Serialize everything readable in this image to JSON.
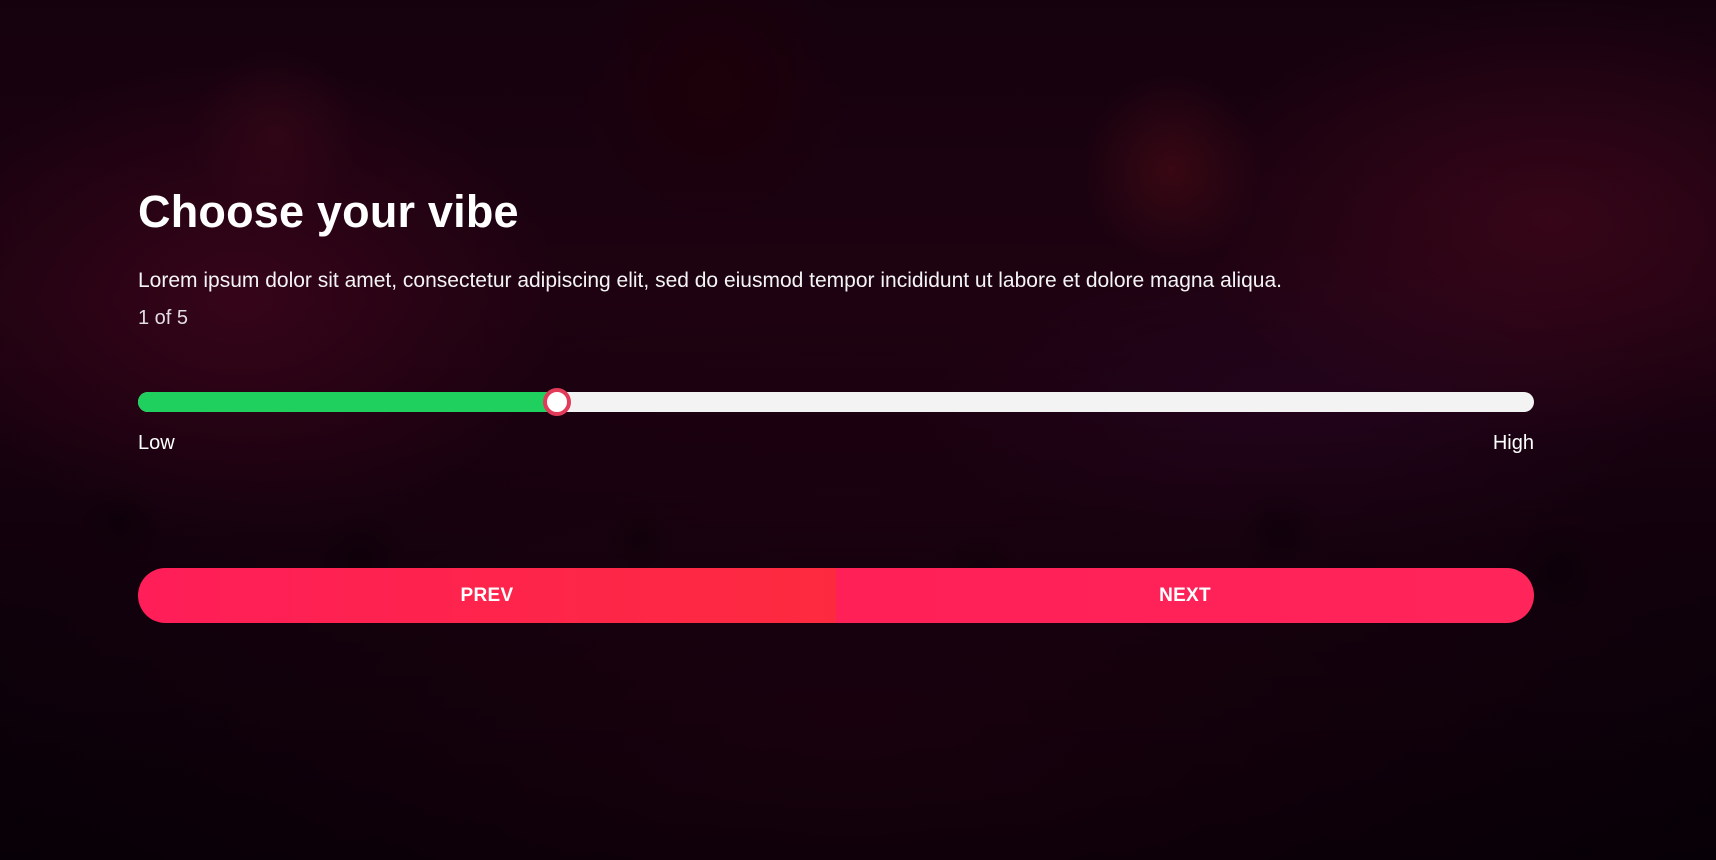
{
  "colors": {
    "accent": "#ff2458",
    "slider_fill": "#1fd05f",
    "slider_track": "#f3f3f3",
    "thumb_border": "#e23a59"
  },
  "question": {
    "title": "Choose your vibe",
    "description": "Lorem ipsum dolor sit amet, consectetur adipiscing elit, sed do eiusmod tempor incididunt ut labore et dolore magna aliqua.",
    "progress": "1 of 5"
  },
  "slider": {
    "value_fraction": 0.3,
    "min_label": "Low",
    "max_label": "High"
  },
  "nav": {
    "prev_label": "PREV",
    "next_label": "NEXT"
  }
}
